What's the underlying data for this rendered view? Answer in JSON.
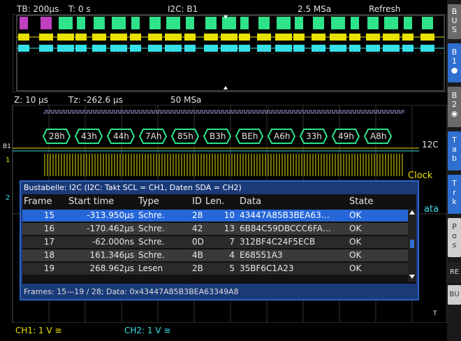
{
  "header": {
    "timebase": "TB: 200µs",
    "trigger_time": "T: 0 s",
    "bus_label": "I2C: B1",
    "sample_rate": "2.5 MSa",
    "refresh": "Refresh"
  },
  "zoom_header": {
    "zoom": "Z: 10 µs",
    "zoom_time": "Tz: -262.6 µs",
    "sample_rate": "50 MSa"
  },
  "bus_decode": {
    "marker": "B1",
    "bytes": [
      "28h",
      "43h",
      "44h",
      "7Ah",
      "85h",
      "B3h",
      "BEh",
      "A6h",
      "33h",
      "49h",
      "A8h"
    ],
    "trailing": "12C"
  },
  "waveform_labels": {
    "clock": "Clock",
    "data": "ata",
    "ch1_marker": "1",
    "ch2_marker": "2",
    "trigger_marker": "T"
  },
  "bus_table": {
    "title": "Bustabelle: I2C (I2C: Takt SCL = CH1, Daten SDA = CH2)",
    "columns": [
      "Frame",
      "Start time",
      "Type",
      "ID",
      "Len.",
      "Data",
      "State"
    ],
    "rows": [
      {
        "frame": "15",
        "start": "-313.950µs",
        "type": "Schre.",
        "id": "28",
        "len": "10",
        "data": "43447A85B3BEA63…",
        "state": "OK"
      },
      {
        "frame": "16",
        "start": "-170.462µs",
        "type": "Schre.",
        "id": "42",
        "len": "13",
        "data": "6B84C59DBCCC6FA…",
        "state": "OK"
      },
      {
        "frame": "17",
        "start": "-62.000ns",
        "type": "Schre.",
        "id": "0D",
        "len": "7",
        "data": "312BF4C24F5ECB",
        "state": "OK"
      },
      {
        "frame": "18",
        "start": "161.346µs",
        "type": "Schre.",
        "id": "4B",
        "len": "4",
        "data": "E68551A3",
        "state": "OK"
      },
      {
        "frame": "19",
        "start": "268.962µs",
        "type": "Lesen",
        "id": "2B",
        "len": "5",
        "data": "35BF6C1A23",
        "state": "OK"
      }
    ],
    "footer": "Frames: 15—19 / 28; Data: 0x43447A85B3BEA63349A8"
  },
  "status_bar": {
    "ch1": "CH1: 1 V ≅",
    "ch2": "CH2: 1 V ≅"
  },
  "softkeys": {
    "bus": [
      "B",
      "U",
      "S"
    ],
    "b1": [
      "B",
      "1"
    ],
    "b2": [
      "B",
      "2"
    ],
    "tab": [
      "T",
      "a",
      "b"
    ],
    "trk": [
      "T",
      "r",
      "k"
    ],
    "pos": [
      "P",
      "o",
      "s"
    ],
    "re": "RE",
    "bu": "BU"
  },
  "colors": {
    "ch1": "#e8e000",
    "ch2": "#35e0e8",
    "bus": "#2ee38a",
    "selection": "#2667d8"
  }
}
